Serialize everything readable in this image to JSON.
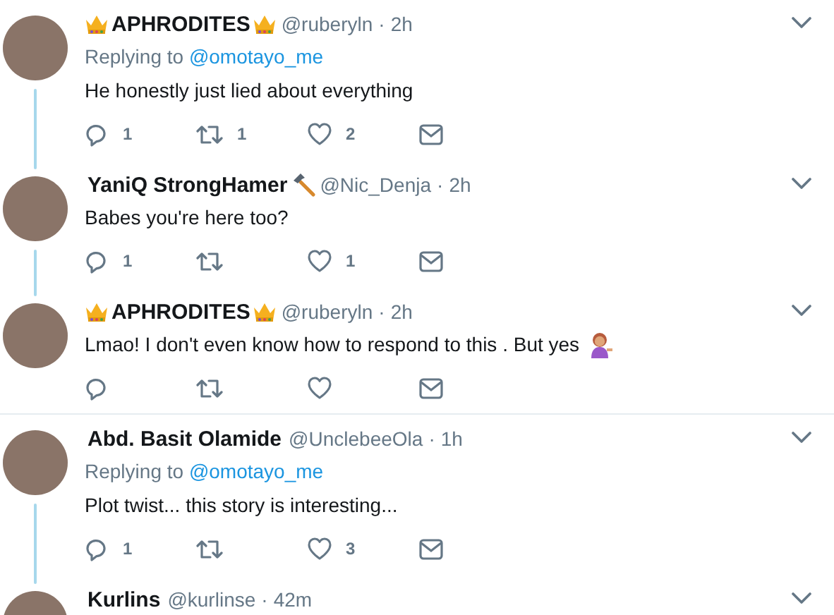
{
  "tweets": [
    {
      "name": "APHRODITES",
      "icons_before_name": [
        {
          "kind": "crown"
        }
      ],
      "icons_after_name": [
        {
          "kind": "crown"
        }
      ],
      "handle": "@ruberyln",
      "separator": "·",
      "time": "2h",
      "replying_label": "Replying to",
      "replying_to": "@omotayo_me",
      "text": "He honestly just lied about everything",
      "actions": [
        {
          "kind": "reply",
          "count": "1"
        },
        {
          "kind": "retweet",
          "count": "1"
        },
        {
          "kind": "like",
          "count": "2"
        },
        {
          "kind": "message"
        }
      ],
      "thread_below": true,
      "divider_below": false
    },
    {
      "name": "YaniQ StrongHamer",
      "icons_after_name": [
        {
          "kind": "hammer"
        }
      ],
      "handle": "@Nic_Denja",
      "separator": "·",
      "time": "2h",
      "text": "Babes you're here too?",
      "actions": [
        {
          "kind": "reply",
          "count": "1"
        },
        {
          "kind": "retweet"
        },
        {
          "kind": "like",
          "count": "1"
        },
        {
          "kind": "message"
        }
      ],
      "thread_below": true,
      "divider_below": false
    },
    {
      "name": "APHRODITES",
      "icons_before_name": [
        {
          "kind": "crown"
        }
      ],
      "icons_after_name": [
        {
          "kind": "crown"
        }
      ],
      "handle": "@ruberyln",
      "separator": "·",
      "time": "2h",
      "text": "Lmao! I don't even know how to respond to this . But yes",
      "text_icons": [
        {
          "kind": "person"
        }
      ],
      "actions": [
        {
          "kind": "reply"
        },
        {
          "kind": "retweet"
        },
        {
          "kind": "like"
        },
        {
          "kind": "message"
        }
      ],
      "thread_below": false,
      "divider_below": true
    },
    {
      "name": "Abd. Basit Olamide",
      "handle": "@UnclebeeOla",
      "separator": "·",
      "time": "1h",
      "replying_label": "Replying to",
      "replying_to": "@omotayo_me",
      "text": "Plot twist... this story is interesting...",
      "actions": [
        {
          "kind": "reply",
          "count": "1"
        },
        {
          "kind": "retweet"
        },
        {
          "kind": "like",
          "count": "3"
        },
        {
          "kind": "message"
        }
      ],
      "thread_below": true,
      "divider_below": false
    },
    {
      "name": "Kurlins",
      "handle": "@kurlinse",
      "separator": "·",
      "time": "42m",
      "thread_below": false,
      "divider_below": false
    }
  ]
}
